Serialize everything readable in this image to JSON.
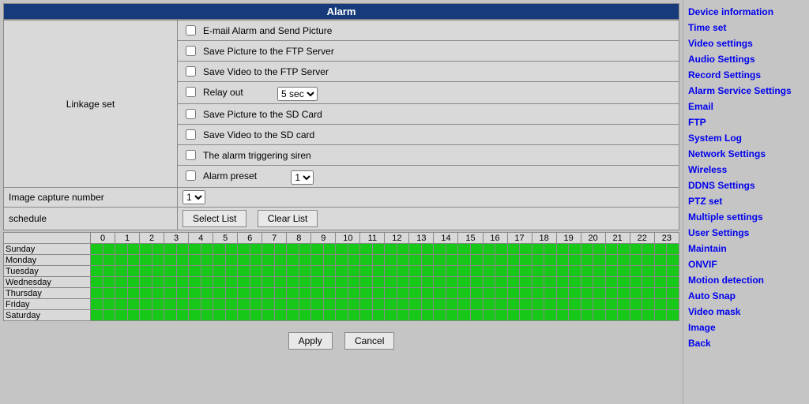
{
  "title": "Alarm",
  "linkage": {
    "section_label": "Linkage set",
    "items": [
      {
        "label": "E-mail Alarm and Send Picture",
        "checked": false
      },
      {
        "label": "Save Picture to the FTP Server",
        "checked": false
      },
      {
        "label": "Save Video to the FTP Server",
        "checked": false
      },
      {
        "label": "Relay out",
        "checked": false,
        "select": "5 sec"
      },
      {
        "label": "Save Picture to the SD Card",
        "checked": false
      },
      {
        "label": "Save Video to the SD card",
        "checked": false
      },
      {
        "label": "The alarm triggering siren",
        "checked": false
      },
      {
        "label": "Alarm preset",
        "checked": false,
        "select": "1"
      }
    ]
  },
  "image_capture": {
    "label": "Image capture number",
    "value": "1"
  },
  "schedule": {
    "label": "schedule",
    "select_list": "Select List",
    "clear_list": "Clear List",
    "hours": [
      "0",
      "1",
      "2",
      "3",
      "4",
      "5",
      "6",
      "7",
      "8",
      "9",
      "10",
      "11",
      "12",
      "13",
      "14",
      "15",
      "16",
      "17",
      "18",
      "19",
      "20",
      "21",
      "22",
      "23"
    ],
    "days": [
      "Sunday",
      "Monday",
      "Tuesday",
      "Wednesday",
      "Thursday",
      "Friday",
      "Saturday"
    ]
  },
  "actions": {
    "apply": "Apply",
    "cancel": "Cancel"
  },
  "sidebar": {
    "items": [
      "Device information",
      "Time set",
      "Video settings",
      "Audio Settings",
      "Record Settings",
      "Alarm Service Settings",
      "Email",
      "FTP",
      "System Log",
      "Network Settings",
      "Wireless",
      "DDNS Settings",
      "PTZ set",
      "Multiple settings",
      "User Settings",
      "Maintain",
      "ONVIF",
      "Motion detection",
      "Auto Snap",
      "Video mask",
      "Image",
      "Back"
    ]
  }
}
